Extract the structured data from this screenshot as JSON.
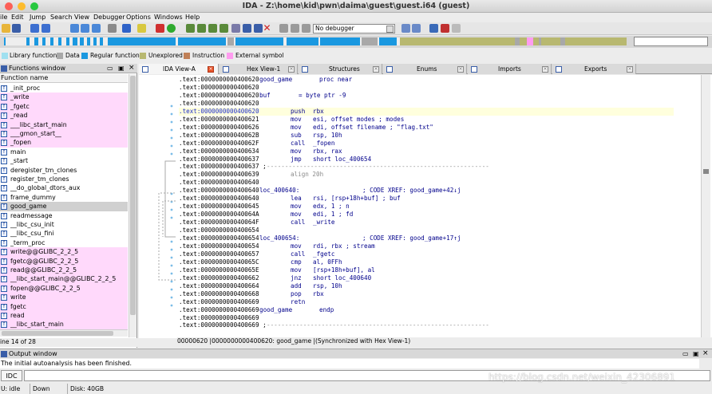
{
  "window": {
    "title": "IDA - Z:\\home\\kid\\pwn\\daima\\guest\\guest.i64 (guest)"
  },
  "menu": [
    "ile",
    "Edit",
    "Jump",
    "Search",
    "View",
    "Debugger",
    "Options",
    "Windows",
    "Help"
  ],
  "toolbar": {
    "debugger_select": "No debugger"
  },
  "legend": [
    {
      "label": "Library function",
      "color": "#a0e0f0"
    },
    {
      "label": "Data",
      "color": "#a8a8a8"
    },
    {
      "label": "Regular function",
      "color": "#1a98e0"
    },
    {
      "label": "Unexplored",
      "color": "#b8b870"
    },
    {
      "label": "Instruction",
      "color": "#c08058"
    },
    {
      "label": "External symbol",
      "color": "#ff9cf0"
    }
  ],
  "functions": {
    "title": "Functions window",
    "column": "Function name",
    "items": [
      {
        "name": "_init_proc",
        "pink": false
      },
      {
        "name": "_write",
        "pink": true
      },
      {
        "name": "_fgetc",
        "pink": true
      },
      {
        "name": "_read",
        "pink": true
      },
      {
        "name": "___libc_start_main",
        "pink": true
      },
      {
        "name": "___gmon_start__",
        "pink": true
      },
      {
        "name": "_fopen",
        "pink": true
      },
      {
        "name": "main",
        "pink": false
      },
      {
        "name": "_start",
        "pink": false
      },
      {
        "name": "deregister_tm_clones",
        "pink": false
      },
      {
        "name": "register_tm_clones",
        "pink": false
      },
      {
        "name": "__do_global_dtors_aux",
        "pink": false
      },
      {
        "name": "frame_dummy",
        "pink": false
      },
      {
        "name": "good_game",
        "pink": false,
        "selected": true
      },
      {
        "name": "readmessage",
        "pink": false
      },
      {
        "name": "__libc_csu_init",
        "pink": false
      },
      {
        "name": "__libc_csu_fini",
        "pink": false
      },
      {
        "name": "_term_proc",
        "pink": false
      },
      {
        "name": "write@@GLIBC_2_2_5",
        "pink": true
      },
      {
        "name": "fgetc@@GLIBC_2_2_5",
        "pink": true
      },
      {
        "name": "read@@GLIBC_2_2_5",
        "pink": true
      },
      {
        "name": "__libc_start_main@@GLIBC_2_2_5",
        "pink": true
      },
      {
        "name": "fopen@@GLIBC_2_2_5",
        "pink": true
      },
      {
        "name": "write",
        "pink": true
      },
      {
        "name": "fgetc",
        "pink": true
      },
      {
        "name": "read",
        "pink": true
      },
      {
        "name": "__libc_start_main",
        "pink": true
      }
    ],
    "status": "ine 14 of 28"
  },
  "tabs": [
    {
      "label": "IDA View-A"
    },
    {
      "label": "Hex View-1"
    },
    {
      "label": "Structures"
    },
    {
      "label": "Enums"
    },
    {
      "label": "Imports"
    },
    {
      "label": "Exports"
    }
  ],
  "disasm": [
    {
      "a": ".text:0000000000400620",
      "l": "good_game",
      "m": "proc near",
      "o": "",
      "c": ""
    },
    {
      "a": ".text:0000000000400620",
      "l": "",
      "m": "",
      "o": "",
      "c": ""
    },
    {
      "a": ".text:0000000000400620",
      "l": "buf",
      "m": "= byte ptr -9",
      "o": "",
      "c": ""
    },
    {
      "a": ".text:0000000000400620",
      "l": "",
      "m": "",
      "o": "",
      "c": ""
    },
    {
      "a": ".text:0000000000400620",
      "l": "",
      "m": "push",
      "o": "rbx",
      "c": "",
      "sel": true
    },
    {
      "a": ".text:0000000000400621",
      "l": "",
      "m": "mov",
      "o": "esi, offset modes ; modes",
      "c": ""
    },
    {
      "a": ".text:0000000000400626",
      "l": "",
      "m": "mov",
      "o": "edi, offset filename ; \"flag.txt\"",
      "c": ""
    },
    {
      "a": ".text:000000000040062B",
      "l": "",
      "m": "sub",
      "o": "rsp, 10h",
      "c": ""
    },
    {
      "a": ".text:000000000040062F",
      "l": "",
      "m": "call",
      "o": "_fopen",
      "c": ""
    },
    {
      "a": ".text:0000000000400634",
      "l": "",
      "m": "mov",
      "o": "rbx, rax",
      "c": ""
    },
    {
      "a": ".text:0000000000400637",
      "l": "",
      "m": "jmp",
      "o": "short loc_400654",
      "c": ""
    },
    {
      "a": ".text:0000000000400637 ;",
      "l": "",
      "m": "",
      "o": "",
      "c": "",
      "sep": true
    },
    {
      "a": ".text:0000000000400639",
      "l": "",
      "m": "align 20h",
      "o": "",
      "c": "",
      "dim": true
    },
    {
      "a": ".text:0000000000400640",
      "l": "",
      "m": "",
      "o": "",
      "c": ""
    },
    {
      "a": ".text:0000000000400640",
      "l": "loc_400640:",
      "m": "",
      "o": "",
      "c": "; CODE XREF: good_game+42↓j"
    },
    {
      "a": ".text:0000000000400640",
      "l": "",
      "m": "lea",
      "o": "rsi, [rsp+18h+buf] ; buf",
      "c": ""
    },
    {
      "a": ".text:0000000000400645",
      "l": "",
      "m": "mov",
      "o": "edx, 1          ; n",
      "c": ""
    },
    {
      "a": ".text:000000000040064A",
      "l": "",
      "m": "mov",
      "o": "edi, 1          ; fd",
      "c": ""
    },
    {
      "a": ".text:000000000040064F",
      "l": "",
      "m": "call",
      "o": "_write",
      "c": ""
    },
    {
      "a": ".text:0000000000400654",
      "l": "",
      "m": "",
      "o": "",
      "c": ""
    },
    {
      "a": ".text:0000000000400654",
      "l": "loc_400654:",
      "m": "",
      "o": "",
      "c": "; CODE XREF: good_game+17↑j"
    },
    {
      "a": ".text:0000000000400654",
      "l": "",
      "m": "mov",
      "o": "rdi, rbx        ; stream",
      "c": ""
    },
    {
      "a": ".text:0000000000400657",
      "l": "",
      "m": "call",
      "o": "_fgetc",
      "c": ""
    },
    {
      "a": ".text:000000000040065C",
      "l": "",
      "m": "cmp",
      "o": "al, 0FFh",
      "c": ""
    },
    {
      "a": ".text:000000000040065E",
      "l": "",
      "m": "mov",
      "o": "[rsp+18h+buf], al",
      "c": ""
    },
    {
      "a": ".text:0000000000400662",
      "l": "",
      "m": "jnz",
      "o": "short loc_400640",
      "c": ""
    },
    {
      "a": ".text:0000000000400664",
      "l": "",
      "m": "add",
      "o": "rsp, 10h",
      "c": ""
    },
    {
      "a": ".text:0000000000400668",
      "l": "",
      "m": "pop",
      "o": "rbx",
      "c": ""
    },
    {
      "a": ".text:0000000000400669",
      "l": "",
      "m": "retn",
      "o": "",
      "c": ""
    },
    {
      "a": ".text:0000000000400669",
      "l": "good_game",
      "m": "endp",
      "o": "",
      "c": ""
    },
    {
      "a": ".text:0000000000400669",
      "l": "",
      "m": "",
      "o": "",
      "c": ""
    },
    {
      "a": ".text:0000000000400669 ;",
      "l": "",
      "m": "",
      "o": "",
      "c": "",
      "sep": true
    }
  ],
  "ida_status": "00000620 |0000000000400620: good_game |(Synchronized with Hex View-1)",
  "output": {
    "title": "Output window",
    "text": "The initial autoanalysis has been finished."
  },
  "idc": {
    "button": "IDC"
  },
  "statusbar": {
    "state": "U: idle",
    "direction": "Down",
    "disk": "Disk: 40GB"
  },
  "watermark": "https://blog.csdn.net/weixin_42306891"
}
